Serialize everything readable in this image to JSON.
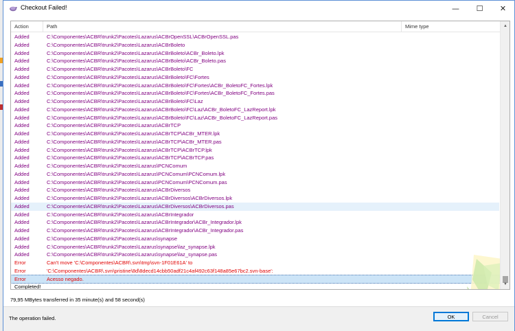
{
  "window": {
    "title": "Checkout Failed!",
    "controls": {
      "minimize": "—",
      "maximize": "☐",
      "close": "✕"
    }
  },
  "columns": {
    "action": "Action",
    "path": "Path",
    "mime": "Mime type"
  },
  "rows": [
    {
      "action": "Added",
      "path": "C:\\Componentes\\ACBR\\trunk2\\Pacotes\\Lazarus\\ACBrOpenSSL\\ACBrOpenSSL.pas",
      "kind": "added"
    },
    {
      "action": "Added",
      "path": "C:\\Componentes\\ACBR\\trunk2\\Pacotes\\Lazarus\\ACBrBoleto",
      "kind": "added"
    },
    {
      "action": "Added",
      "path": "C:\\Componentes\\ACBR\\trunk2\\Pacotes\\Lazarus\\ACBrBoleto\\ACBr_Boleto.lpk",
      "kind": "added"
    },
    {
      "action": "Added",
      "path": "C:\\Componentes\\ACBR\\trunk2\\Pacotes\\Lazarus\\ACBrBoleto\\ACBr_Boleto.pas",
      "kind": "added"
    },
    {
      "action": "Added",
      "path": "C:\\Componentes\\ACBR\\trunk2\\Pacotes\\Lazarus\\ACBrBoleto\\FC",
      "kind": "added"
    },
    {
      "action": "Added",
      "path": "C:\\Componentes\\ACBR\\trunk2\\Pacotes\\Lazarus\\ACBrBoleto\\FC\\Fortes",
      "kind": "added"
    },
    {
      "action": "Added",
      "path": "C:\\Componentes\\ACBR\\trunk2\\Pacotes\\Lazarus\\ACBrBoleto\\FC\\Fortes\\ACBr_BoletoFC_Fortes.lpk",
      "kind": "added"
    },
    {
      "action": "Added",
      "path": "C:\\Componentes\\ACBR\\trunk2\\Pacotes\\Lazarus\\ACBrBoleto\\FC\\Fortes\\ACBr_BoletoFC_Fortes.pas",
      "kind": "added"
    },
    {
      "action": "Added",
      "path": "C:\\Componentes\\ACBR\\trunk2\\Pacotes\\Lazarus\\ACBrBoleto\\FC\\Laz",
      "kind": "added"
    },
    {
      "action": "Added",
      "path": "C:\\Componentes\\ACBR\\trunk2\\Pacotes\\Lazarus\\ACBrBoleto\\FC\\Laz\\ACBr_BoletoFC_LazReport.lpk",
      "kind": "added"
    },
    {
      "action": "Added",
      "path": "C:\\Componentes\\ACBR\\trunk2\\Pacotes\\Lazarus\\ACBrBoleto\\FC\\Laz\\ACBr_BoletoFC_LazReport.pas",
      "kind": "added"
    },
    {
      "action": "Added",
      "path": "C:\\Componentes\\ACBR\\trunk2\\Pacotes\\Lazarus\\ACBrTCP",
      "kind": "added"
    },
    {
      "action": "Added",
      "path": "C:\\Componentes\\ACBR\\trunk2\\Pacotes\\Lazarus\\ACBrTCP\\ACBr_MTER.lpk",
      "kind": "added"
    },
    {
      "action": "Added",
      "path": "C:\\Componentes\\ACBR\\trunk2\\Pacotes\\Lazarus\\ACBrTCP\\ACBr_MTER.pas",
      "kind": "added"
    },
    {
      "action": "Added",
      "path": "C:\\Componentes\\ACBR\\trunk2\\Pacotes\\Lazarus\\ACBrTCP\\ACBrTCP.lpk",
      "kind": "added"
    },
    {
      "action": "Added",
      "path": "C:\\Componentes\\ACBR\\trunk2\\Pacotes\\Lazarus\\ACBrTCP\\ACBrTCP.pas",
      "kind": "added"
    },
    {
      "action": "Added",
      "path": "C:\\Componentes\\ACBR\\trunk2\\Pacotes\\Lazarus\\PCNComum",
      "kind": "added"
    },
    {
      "action": "Added",
      "path": "C:\\Componentes\\ACBR\\trunk2\\Pacotes\\Lazarus\\PCNComum\\PCNComum.lpk",
      "kind": "added"
    },
    {
      "action": "Added",
      "path": "C:\\Componentes\\ACBR\\trunk2\\Pacotes\\Lazarus\\PCNComum\\PCNComum.pas",
      "kind": "added"
    },
    {
      "action": "Added",
      "path": "C:\\Componentes\\ACBR\\trunk2\\Pacotes\\Lazarus\\ACBrDiversos",
      "kind": "added"
    },
    {
      "action": "Added",
      "path": "C:\\Componentes\\ACBR\\trunk2\\Pacotes\\Lazarus\\ACBrDiversos\\ACBrDiversos.lpk",
      "kind": "added"
    },
    {
      "action": "Added",
      "path": "C:\\Componentes\\ACBR\\trunk2\\Pacotes\\Lazarus\\ACBrDiversos\\ACBrDiversos.pas",
      "kind": "added",
      "state": "hover"
    },
    {
      "action": "Added",
      "path": "C:\\Componentes\\ACBR\\trunk2\\Pacotes\\Lazarus\\ACBrIntegrador",
      "kind": "added"
    },
    {
      "action": "Added",
      "path": "C:\\Componentes\\ACBR\\trunk2\\Pacotes\\Lazarus\\ACBrIntegrador\\ACBr_Integrador.lpk",
      "kind": "added"
    },
    {
      "action": "Added",
      "path": "C:\\Componentes\\ACBR\\trunk2\\Pacotes\\Lazarus\\ACBrIntegrador\\ACBr_Integrador.pas",
      "kind": "added"
    },
    {
      "action": "Added",
      "path": "C:\\Componentes\\ACBR\\trunk2\\Pacotes\\Lazarus\\synapse",
      "kind": "added"
    },
    {
      "action": "Added",
      "path": "C:\\Componentes\\ACBR\\trunk2\\Pacotes\\Lazarus\\synapse\\laz_synapse.lpk",
      "kind": "added"
    },
    {
      "action": "Added",
      "path": "C:\\Componentes\\ACBR\\trunk2\\Pacotes\\Lazarus\\synapse\\laz_synapse.pas",
      "kind": "added"
    },
    {
      "action": "Error",
      "path": "Can't move 'C:\\Componentes\\ACBR\\.svn\\tmp\\svn-1F01E61A' to",
      "kind": "error"
    },
    {
      "action": "Error",
      "path": " 'C:\\Componentes\\ACBR\\.svn\\pristine\\8d\\8decd14cbb50adf21c4af492c63f148a85e67bc2.svn-base':",
      "kind": "error"
    },
    {
      "action": "Error",
      "path": "Acesso negado.",
      "kind": "error",
      "state": "selected"
    },
    {
      "action": "Completed!",
      "path": "",
      "kind": "plain"
    }
  ],
  "transfer_info": "79,95 MBytes transferred in 35 minute(s) and 58 second(s)",
  "status": "The operation failed.",
  "buttons": {
    "ok": "OK",
    "cancel": "Cancel"
  },
  "colors": {
    "added": "#800080",
    "error": "#e00000",
    "accent": "#0078d7"
  }
}
